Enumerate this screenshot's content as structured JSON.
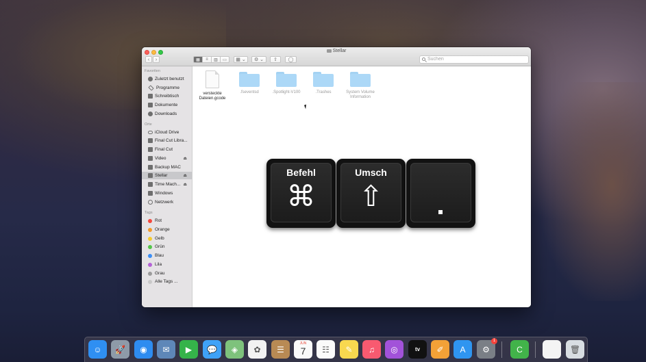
{
  "window": {
    "title": "Stellar"
  },
  "toolbar": {
    "back_label": "‹",
    "forward_label": "›",
    "view_icons": [
      "▦",
      "≡",
      "▥",
      "▭"
    ],
    "group_label": "▦ ⌄",
    "action_label": "⚙ ⌄",
    "share_label": "⇧",
    "tag_label": "◯"
  },
  "search": {
    "placeholder": "Suchen"
  },
  "sidebar": {
    "favorites_title": "Favoriten",
    "favorites": [
      {
        "label": "Zuletzt benutzt",
        "icon": "clock-icon"
      },
      {
        "label": "Programme",
        "icon": "apps-icon"
      },
      {
        "label": "Schreibtisch",
        "icon": "desktop-icon"
      },
      {
        "label": "Dokumente",
        "icon": "document-icon"
      },
      {
        "label": "Downloads",
        "icon": "download-icon"
      }
    ],
    "locations_title": "Orte",
    "locations": [
      {
        "label": "iCloud Drive",
        "icon": "cloud-icon"
      },
      {
        "label": "Final Cut Libra...",
        "icon": "disk-icon"
      },
      {
        "label": "Final Cut",
        "icon": "disk-icon"
      },
      {
        "label": "Video",
        "icon": "disk-icon",
        "eject": "⏏"
      },
      {
        "label": "Backup MAC",
        "icon": "disk-icon"
      },
      {
        "label": "Stellar",
        "icon": "disk-icon",
        "eject": "⏏",
        "selected": true
      },
      {
        "label": "Time Mach...",
        "icon": "disk-icon",
        "eject": "⏏"
      },
      {
        "label": "Windows",
        "icon": "disk-icon"
      },
      {
        "label": "Netzwerk",
        "icon": "globe-icon"
      }
    ],
    "tags_title": "Tags",
    "tags": [
      {
        "label": "Rot",
        "color": "#f4473d"
      },
      {
        "label": "Orange",
        "color": "#f39a2b"
      },
      {
        "label": "Gelb",
        "color": "#f5cc30"
      },
      {
        "label": "Grün",
        "color": "#53c54a"
      },
      {
        "label": "Blau",
        "color": "#3a8ef6"
      },
      {
        "label": "Lila",
        "color": "#b462d6"
      },
      {
        "label": "Grau",
        "color": "#9b9b9b"
      },
      {
        "label": "Alle Tags ...",
        "color": "#c9c9c9"
      }
    ]
  },
  "files": [
    {
      "name": "versteckte Dateien.gcode",
      "line1": "versteckte",
      "line2": "Dateien.gcode",
      "kind": "document",
      "hidden": false
    },
    {
      "name": ".fseventsd",
      "line1": ".fseventsd",
      "line2": "",
      "kind": "folder",
      "hidden": true
    },
    {
      "name": ".Spotlight-V100",
      "line1": ".Spotlight-V100",
      "line2": "",
      "kind": "folder",
      "hidden": true
    },
    {
      "name": ".Trashes",
      "line1": ".Trashes",
      "line2": "",
      "kind": "folder",
      "hidden": true
    },
    {
      "name": "System Volume Information",
      "line1": "System Volume",
      "line2": "Information",
      "kind": "folder",
      "hidden": true
    }
  ],
  "shortcut": {
    "keys": [
      {
        "label": "Befehl",
        "glyph": "⌘"
      },
      {
        "label": "Umsch",
        "glyph": "⇧"
      },
      {
        "label": "",
        "glyph": "."
      }
    ]
  },
  "dock": {
    "apps": [
      {
        "name": "finder-icon",
        "color": "#2f8ff2",
        "glyph": "☺"
      },
      {
        "name": "launchpad-icon",
        "color": "#8e9aa8",
        "glyph": "🚀"
      },
      {
        "name": "safari-icon",
        "color": "#2e8cf0",
        "glyph": "◉"
      },
      {
        "name": "mail-icon",
        "color": "#5e87b8",
        "glyph": "✉"
      },
      {
        "name": "facetime-icon",
        "color": "#35b34a",
        "glyph": "▶"
      },
      {
        "name": "messages-icon",
        "color": "#3fa2f7",
        "glyph": "💬"
      },
      {
        "name": "maps-icon",
        "color": "#7ec27c",
        "glyph": "◈"
      },
      {
        "name": "photos-icon",
        "color": "#f2f2f2",
        "glyph": "✿"
      },
      {
        "name": "contacts-icon",
        "color": "#b88a54",
        "glyph": "☰"
      },
      {
        "name": "calendar-icon",
        "color": "#fafafa",
        "glyph": "",
        "month": "JUN",
        "day": "7"
      },
      {
        "name": "reminders-icon",
        "color": "#fafafa",
        "glyph": "☷"
      },
      {
        "name": "notes-icon",
        "color": "#f8d84f",
        "glyph": "✎"
      },
      {
        "name": "music-icon",
        "color": "#f85a70",
        "glyph": "♫"
      },
      {
        "name": "podcasts-icon",
        "color": "#a252d9",
        "glyph": "◎"
      },
      {
        "name": "appletv-icon",
        "color": "#111111",
        "glyph": "tv"
      },
      {
        "name": "pages-icon",
        "color": "#f3a137",
        "glyph": "✐"
      },
      {
        "name": "appstore-icon",
        "color": "#2f95f0",
        "glyph": "A"
      },
      {
        "name": "system-preferences-icon",
        "color": "#7a7f86",
        "glyph": "⚙",
        "badge": "1"
      },
      {
        "name": "camtasia-icon",
        "color": "#42b34a",
        "glyph": "C"
      },
      {
        "name": "document-icon",
        "color": "#f4f4f4",
        "glyph": ""
      },
      {
        "name": "trash-icon",
        "color": "#d8dde2",
        "glyph": "🗑"
      }
    ]
  }
}
